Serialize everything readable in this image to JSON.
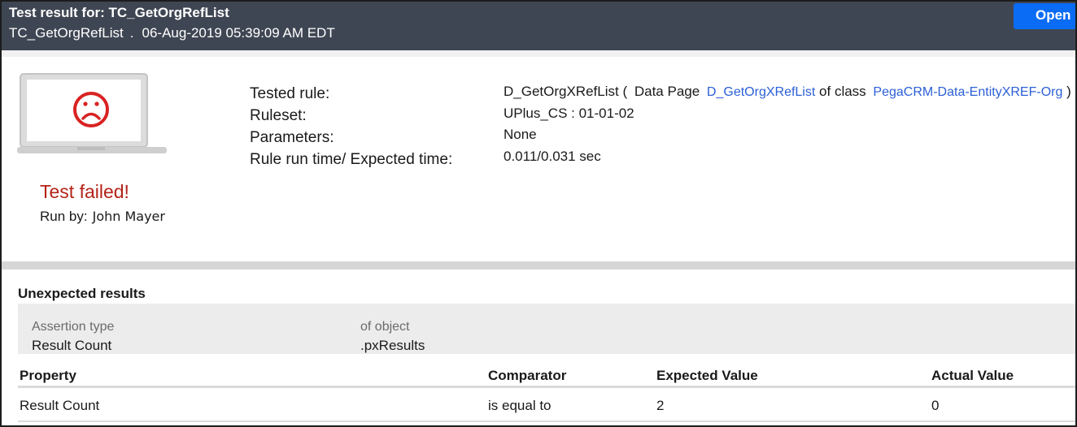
{
  "header": {
    "title": "Test result for:  TC_GetOrgRefList",
    "test_case": "TC_GetOrgRefList",
    "separator": ".",
    "timestamp": "06-Aug-2019 05:39:09 AM EDT",
    "open_button": "Open"
  },
  "summary": {
    "status_icon": "sad-face-laptop-icon",
    "status_color": "#b42318",
    "status": "Test failed!",
    "run_by_label": "Run by:",
    "run_by_name": "John Mayer"
  },
  "details": {
    "tested_rule_label": "Tested rule:",
    "ruleset_label": "Ruleset:",
    "parameters_label": "Parameters:",
    "run_time_label": "Rule run time/ Expected time:",
    "tested_rule_name": "D_GetOrgXRefList (",
    "tested_rule_type": "Data Page",
    "tested_rule_link": "D_GetOrgXRefList",
    "of_class_label": "of class",
    "class_link": "PegaCRM-Data-EntityXREF-Org",
    "close_paren": ")",
    "ruleset": "UPlus_CS : 01-01-02",
    "parameters": "None",
    "run_time": "0.011",
    "time_sep": "/",
    "expected_time": "0.031 sec",
    "link_color": "#2b5fd6"
  },
  "unexpected": {
    "title": "Unexpected results",
    "assertion_type_label": "Assertion type",
    "assertion_type_value": "Result Count",
    "of_object_label": "of object",
    "of_object_value": ".pxResults",
    "columns": [
      "Property",
      "Comparator",
      "Expected Value",
      "Actual Value"
    ],
    "rows": [
      [
        "Result Count",
        "is equal to",
        "2",
        "0"
      ]
    ]
  }
}
